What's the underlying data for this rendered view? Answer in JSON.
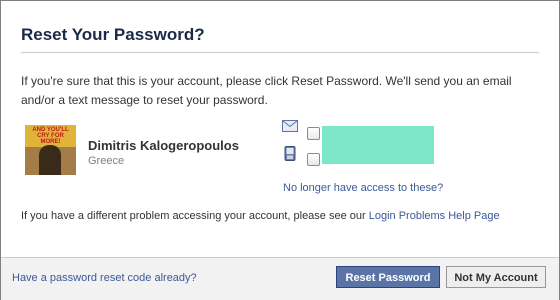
{
  "dialog": {
    "title": "Reset Your Password?",
    "intro": "If you're sure that this is your account, please click Reset Password. We'll send you an email and/or a text message to reset your password."
  },
  "account": {
    "name": "Dimitris Kalogeropoulos",
    "location": "Greece",
    "avatar_caption": "AND YOU'LL CRY FOR MORE!"
  },
  "contact_options": {
    "no_access_link": "No longer have access to these?",
    "email_icon": "envelope-icon",
    "phone_icon": "mobile-phone-icon",
    "redaction_color": "#7de6c8"
  },
  "problem": {
    "text": "If you have a different problem accessing your account, please see our ",
    "link": "Login Problems Help Page"
  },
  "footer": {
    "reset_code_link": "Have a password reset code already?",
    "reset_button": "Reset Password",
    "not_my_account_button": "Not My Account"
  },
  "colors": {
    "title": "#1c2a47",
    "link": "#3b5998",
    "primary_button": "#5b74a8",
    "footer_bg": "#f2f2f2"
  }
}
